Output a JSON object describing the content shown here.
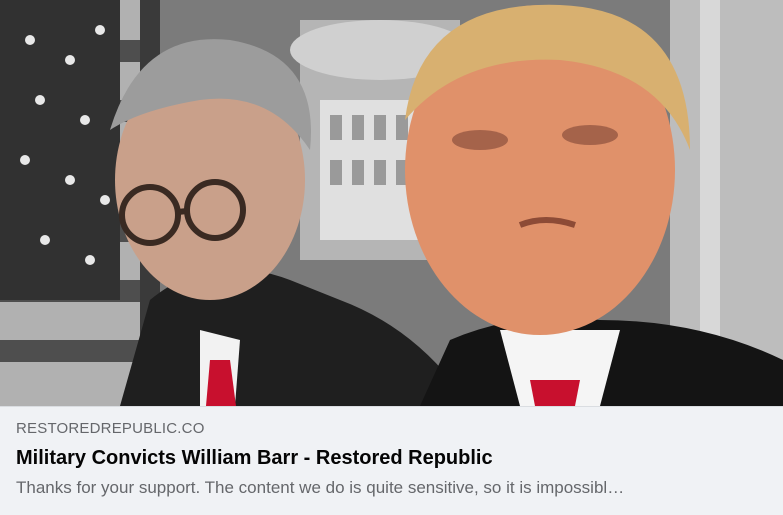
{
  "link_preview": {
    "domain": "RESTOREDREPUBLIC.CO",
    "title": "Military Convicts William Barr - Restored Republic",
    "description": "Thanks for your support. The content we do is quite sensitive, so it is impossibl…"
  },
  "colors": {
    "meta_background": "#f0f2f5",
    "title_text": "#050505",
    "secondary_text": "#65676b",
    "tie_red": "#c8102e"
  }
}
